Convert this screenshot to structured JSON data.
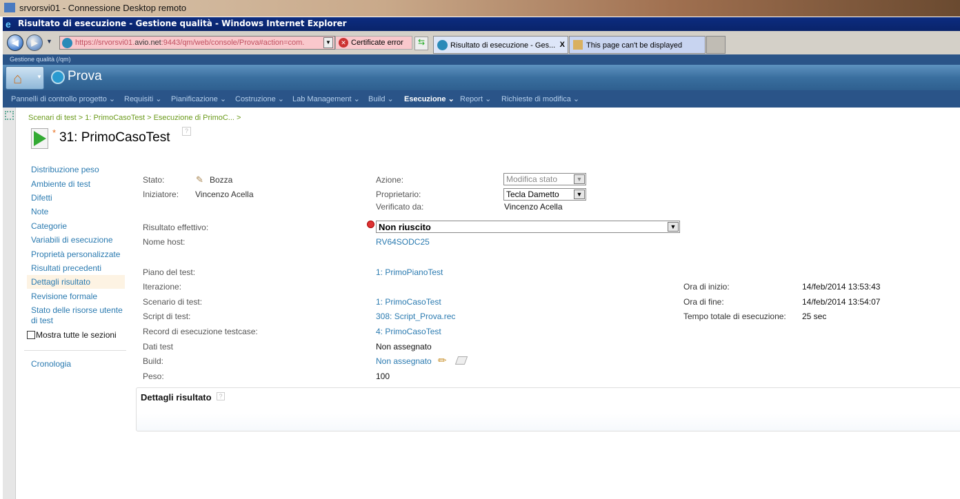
{
  "rdp": {
    "title": "srvorsvi01 - Connessione Desktop remoto"
  },
  "browser": {
    "title": "Risultato di esecuzione - Gestione qualità - Windows Internet Explorer",
    "address_prefix": "https://srvorsvi01.",
    "address_domain": "avio.net",
    "address_rest": ":9443/qm/web/console/Prova#action=com.",
    "cert_error": "Certificate error",
    "tabs": [
      {
        "label": "Risultato di esecuzione - Ges...",
        "active": true,
        "close": "X"
      },
      {
        "label": "This page can't be displayed",
        "active": false
      }
    ]
  },
  "app": {
    "context": "Gestione qualità (/qm)",
    "project": "Prova",
    "nav": [
      {
        "label": "Pannelli di controllo progetto"
      },
      {
        "label": "Requisiti"
      },
      {
        "label": "Pianificazione"
      },
      {
        "label": "Costruzione"
      },
      {
        "label": "Lab Management"
      },
      {
        "label": "Build"
      },
      {
        "label": "Esecuzione",
        "active": true
      },
      {
        "label": "Report"
      },
      {
        "label": "Richieste di modifica"
      }
    ]
  },
  "breadcrumb": "Scenari di test > 1: PrimoCasoTest > Esecuzione di PrimoC... >",
  "page": {
    "title": "31: PrimoCasoTest",
    "modified_marker": "*",
    "help": "?"
  },
  "sidebar": {
    "items": [
      "Distribuzione peso",
      "Ambiente di test",
      "Difetti",
      "Note",
      "Categorie",
      "Variabili di esecuzione",
      "Proprietà personalizzate",
      "Risultati precedenti",
      "Dettagli risultato",
      "Revisione formale",
      "Stato delle risorse utente di test"
    ],
    "selected": "Dettagli risultato",
    "show_all": "Mostra tutte le sezioni",
    "show_all_checked": false,
    "history": "Cronologia"
  },
  "fields": {
    "stato": {
      "label": "Stato:",
      "value": "Bozza"
    },
    "iniziatore": {
      "label": "Iniziatore:",
      "value": "Vincenzo Acella"
    },
    "azione": {
      "label": "Azione:",
      "value": "Modifica stato"
    },
    "proprietario": {
      "label": "Proprietario:",
      "value": "Tecla Dametto"
    },
    "verificato": {
      "label": "Verificato da:",
      "value": "Vincenzo Acella"
    },
    "risultato": {
      "label": "Risultato effettivo:",
      "value": "Non riuscito"
    },
    "host": {
      "label": "Nome host:",
      "value": "RV64SODC25"
    },
    "piano": {
      "label": "Piano del test:",
      "value": "1: PrimoPianoTest"
    },
    "iterazione": {
      "label": "Iterazione:",
      "value": ""
    },
    "scenario": {
      "label": "Scenario di test:",
      "value": "1: PrimoCasoTest"
    },
    "script": {
      "label": "Script di test:",
      "value": "308: Script_Prova.rec"
    },
    "record": {
      "label": "Record di esecuzione testcase:",
      "value": "4: PrimoCasoTest"
    },
    "dati": {
      "label": "Dati test",
      "value": "Non assegnato"
    },
    "build": {
      "label": "Build:",
      "value": "Non assegnato"
    },
    "peso": {
      "label": "Peso:",
      "value": "100"
    },
    "inizio": {
      "label": "Ora di inizio:",
      "value": "14/feb/2014 13:53:43"
    },
    "fine": {
      "label": "Ora di fine:",
      "value": "14/feb/2014 13:54:07"
    },
    "tempo": {
      "label": "Tempo totale di esecuzione:",
      "value": "25 sec"
    }
  },
  "details": {
    "title": "Dettagli risultato",
    "help": "?"
  }
}
